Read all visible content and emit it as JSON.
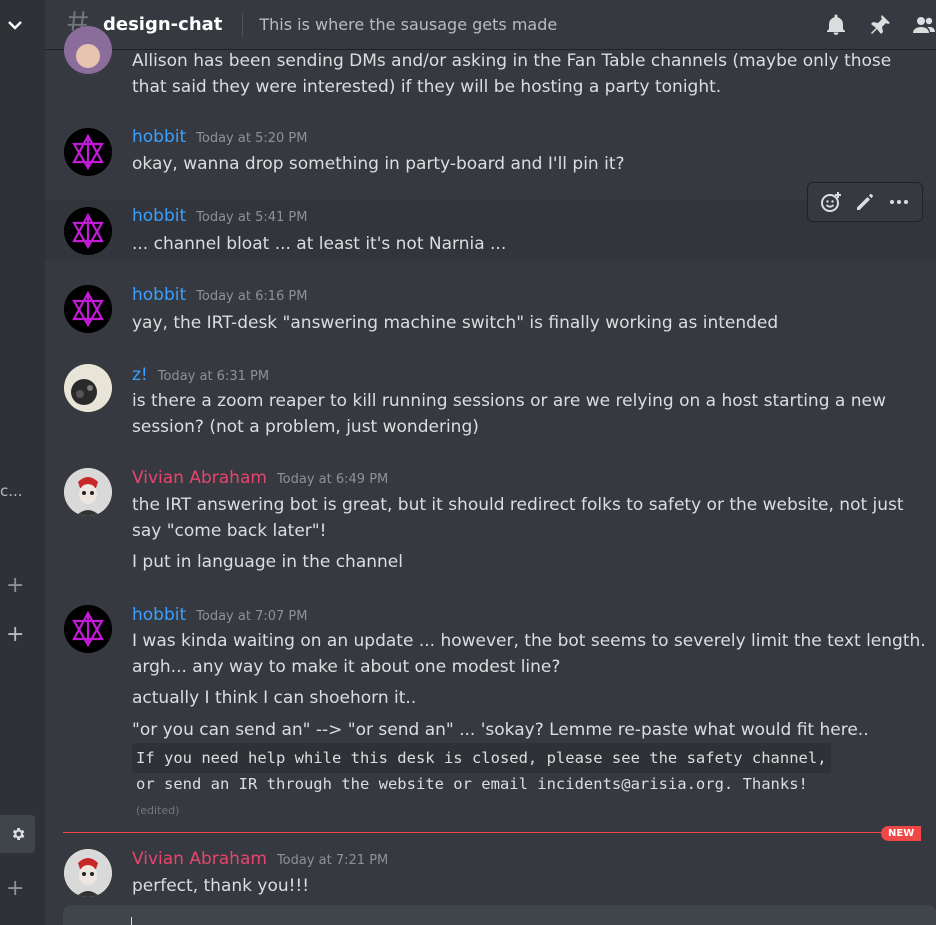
{
  "sidebar": {
    "truncated_label": "c..."
  },
  "header": {
    "channel_name": "design-chat",
    "topic": "This is where the sausage gets made"
  },
  "messages": [
    {
      "id": "m0",
      "lines": [
        "Allison has been sending DMs and/or asking in the Fan Table channels (maybe only those",
        "that said they were interested) if they will be hosting a party tonight."
      ]
    },
    {
      "id": "m1",
      "author": "hobbit",
      "timestamp": "Today at 5:20 PM",
      "lines": [
        "okay, wanna drop something in party-board and I'll pin it?"
      ]
    },
    {
      "id": "m2",
      "author": "hobbit",
      "timestamp": "Today at 5:41 PM",
      "lines": [
        "... channel bloat ... at least it's not Narnia ..."
      ]
    },
    {
      "id": "m3",
      "author": "hobbit",
      "timestamp": "Today at 6:16 PM",
      "lines": [
        "yay, the IRT-desk \"answering machine switch\" is finally working as intended"
      ]
    },
    {
      "id": "m4",
      "author": "z!",
      "timestamp": "Today at 6:31 PM",
      "lines": [
        "is there a zoom reaper to kill running sessions or are we relying on a host starting a new",
        "session? (not a problem, just wondering)"
      ]
    },
    {
      "id": "m5",
      "author": "Vivian Abraham",
      "timestamp": "Today at 6:49 PM",
      "lines": [
        "the IRT answering bot is great, but it should redirect folks to safety or the website, not just",
        "say \"come back later\"!",
        "I put in language in the channel"
      ]
    },
    {
      "id": "m6",
      "author": "hobbit",
      "timestamp": "Today at 7:07 PM",
      "lines": [
        "I was kinda waiting on an update ...  however, the bot seems to severely limit the text length.",
        "argh...  any way to make it about one modest line?",
        "actually I think I can shoehorn it..",
        "\"or you can send an\" --> \"or send an\"  ... 'sokay?  Lemme re-paste what would fit here.."
      ],
      "code": [
        "If you need help while this desk is closed, please see the safety channel,",
        "or send an IR through the website or email incidents@arisia.org. Thanks!"
      ],
      "edited": "(edited)"
    },
    {
      "id": "m7",
      "author": "Vivian Abraham",
      "timestamp": "Today at 7:21 PM",
      "lines": [
        "perfect, thank you!!!"
      ]
    }
  ],
  "new_badge": "NEW",
  "colors": {
    "hobbit": "#3ba0ff",
    "vivian": "#e8456e",
    "new": "#f04747",
    "background": "#36393f"
  },
  "icons": [
    "chevron-down-icon",
    "hash-icon",
    "bell-icon",
    "pin-icon",
    "members-icon",
    "add-reaction-icon",
    "edit-icon",
    "more-icon",
    "gear-icon",
    "plus-icon"
  ]
}
